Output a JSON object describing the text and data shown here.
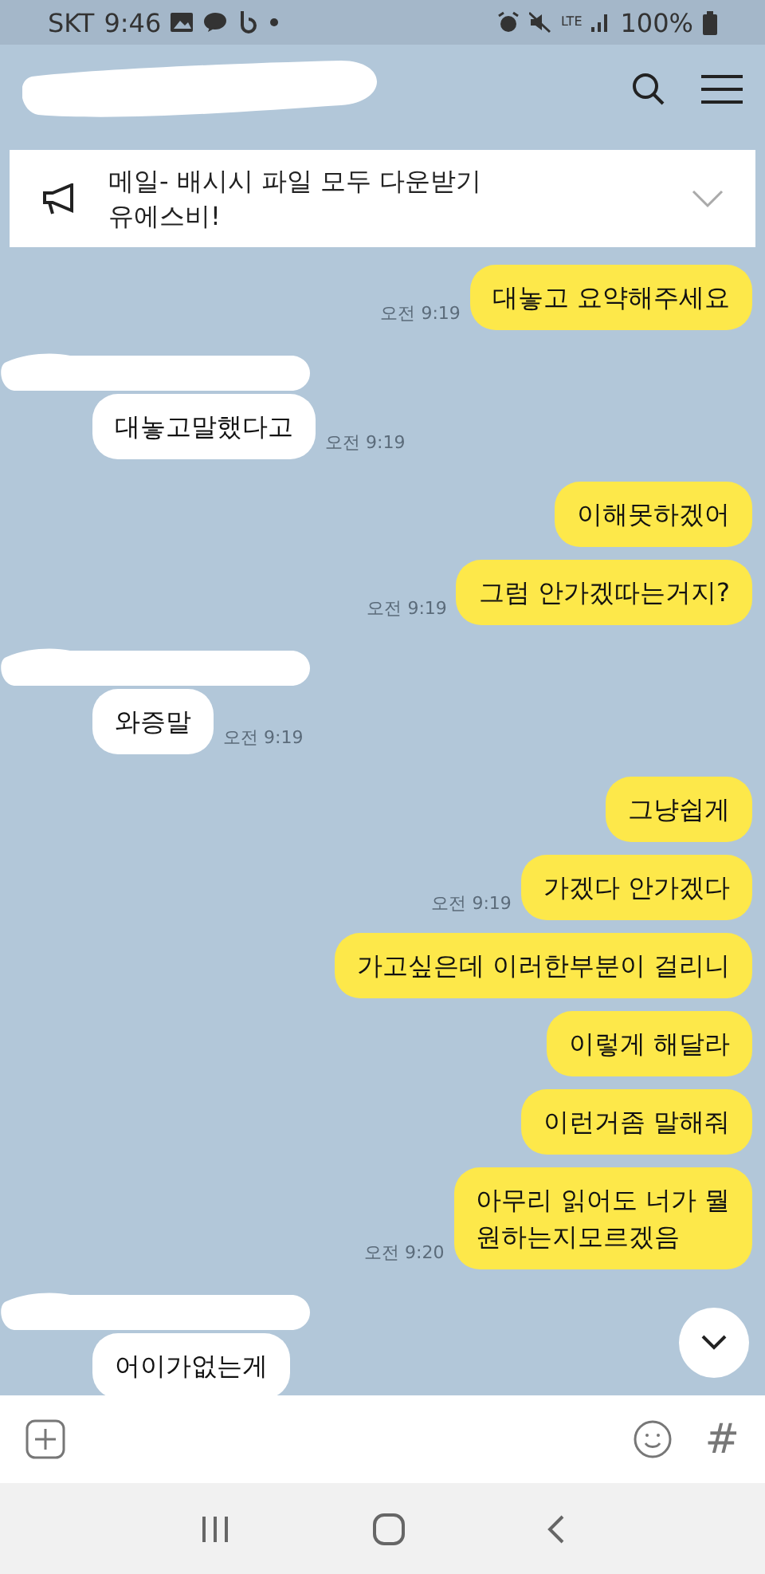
{
  "status_bar": {
    "carrier": "SKT",
    "time": "9:46",
    "network": "LTE",
    "battery": "100%"
  },
  "notice": {
    "text": "메일- 배시시 파일 모두 다운받기\n유에스비!",
    "expanded": false
  },
  "groups": [
    {
      "kind": "outgoing",
      "messages": [
        {
          "text": "대놓고 요약해주세요",
          "time": "오전 9:19"
        }
      ]
    },
    {
      "kind": "incoming",
      "messages": [
        {
          "text": "대놓고말했다고",
          "time": "오전 9:19"
        }
      ]
    },
    {
      "kind": "outgoing",
      "messages": [
        {
          "text": "이해못하겠어"
        },
        {
          "text": "그럼 안가겠따는거지?",
          "time": "오전 9:19"
        }
      ]
    },
    {
      "kind": "incoming",
      "messages": [
        {
          "text": "와증말",
          "time": "오전 9:19"
        }
      ]
    },
    {
      "kind": "outgoing",
      "messages": [
        {
          "text": "그냥쉽게"
        },
        {
          "text": "가겠다 안가겠다",
          "time": "오전 9:19"
        },
        {
          "text": "가고싶은데 이러한부분이 걸리니"
        },
        {
          "text": "이렇게 해달라"
        },
        {
          "text": "이런거좀 말해줘"
        },
        {
          "text": "아무리 읽어도 너가 뭘\n원하는지모르겠음",
          "time": "오전 9:20"
        }
      ]
    },
    {
      "kind": "incoming",
      "messages": [
        {
          "text": "어이가없는게"
        }
      ]
    }
  ],
  "composer": {
    "hash": "#"
  }
}
